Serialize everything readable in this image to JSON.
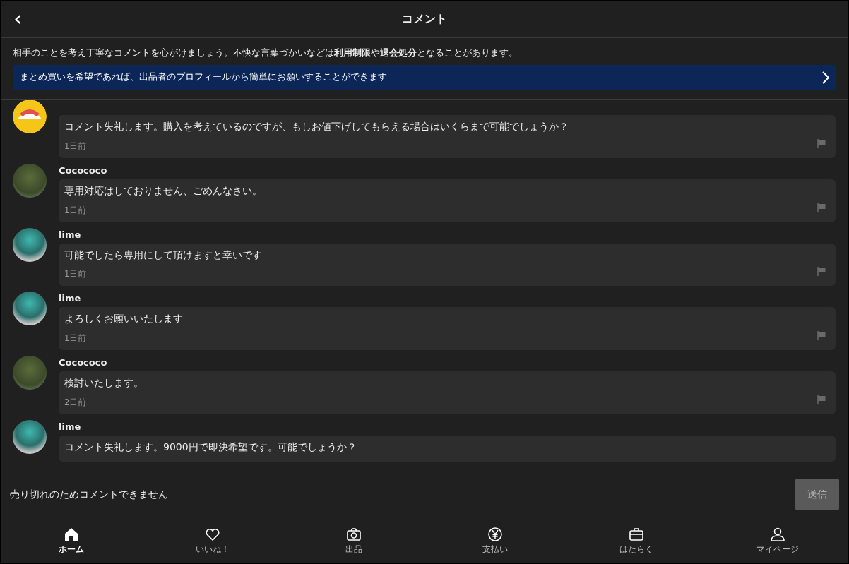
{
  "header": {
    "back": "‹",
    "title": "コメント"
  },
  "notice": {
    "text": "相手のことを考え丁寧なコメントを心がけましょう。不快な言葉づかいなどは**利用制限**や**退会処分**となることがあります。",
    "banner": "まとめ買いを希望であれば、出品者のプロフィールから簡単にお願いすることができます"
  },
  "comments": [
    {
      "kind": "badge",
      "text": "コメント失礼します。購入を考えているのですが、もしお値下げしてもらえる場合はいくらまで可能でしょうか？",
      "time": "1日前"
    },
    {
      "kind": "photo",
      "name": "Cocococo",
      "text": "専用対応はしておりません、ごめんなさい。",
      "time": "1日前"
    },
    {
      "kind": "picture",
      "name": "lime",
      "text": "可能でしたら専用にして頂けますと幸いです",
      "time": "1日前"
    },
    {
      "kind": "picture",
      "name": "lime",
      "text": "よろしくお願いいたします",
      "time": "1日前"
    },
    {
      "kind": "photo",
      "name": "Cocococo",
      "text": "検討いたします。",
      "time": "2日前"
    },
    {
      "kind": "picture",
      "name": "lime",
      "text": "コメント失礼します。9000円で即決希望です。可能でしょうか？"
    }
  ],
  "composer": {
    "message": "売り切れのためコメントできません",
    "send": "送信",
    "disabled": true
  },
  "tabs": [
    {
      "label": "ホーム",
      "selected": true
    },
    {
      "label": "いいね！",
      "selected": false
    },
    {
      "label": "出品",
      "selected": false
    },
    {
      "label": "支払い",
      "selected": false
    },
    {
      "label": "はたらく",
      "selected": false
    },
    {
      "label": "マイページ",
      "selected": false
    }
  ]
}
